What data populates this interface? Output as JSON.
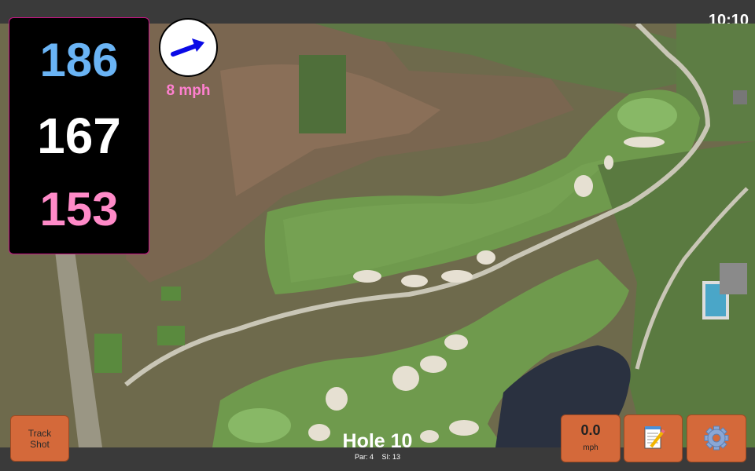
{
  "status_bar": {
    "time": "10:10"
  },
  "distances": {
    "back": "186",
    "middle": "167",
    "front": "153"
  },
  "wind": {
    "speed_label": "8 mph",
    "direction": "east-northeast"
  },
  "hole": {
    "title": "Hole 10",
    "par": "Par: 4",
    "stroke_index": "SI: 13"
  },
  "buttons": {
    "track_shot": "Track Shot",
    "speed_value": "0.0",
    "speed_unit": "mph",
    "notes_icon": "notepad-icon",
    "settings_icon": "gear-icon"
  },
  "colors": {
    "accent_orange": "#d4693a",
    "back_distance": "#6ab4f5",
    "front_distance": "#ff8ac8",
    "wind_arrow": "#0a0ae6"
  }
}
